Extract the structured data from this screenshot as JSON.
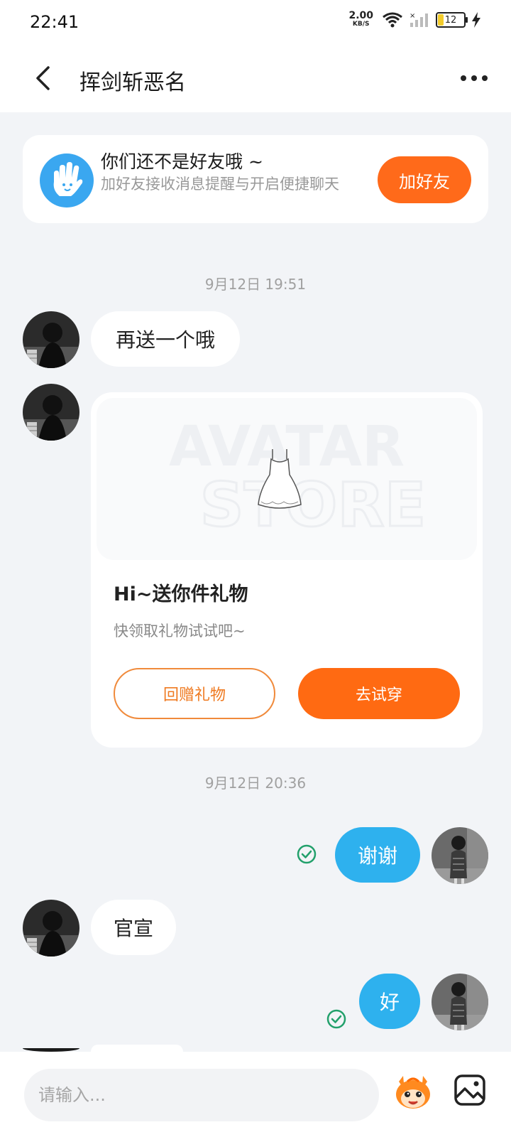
{
  "status_bar": {
    "time": "22:41",
    "net_speed_value": "2.00",
    "net_speed_unit": "KB/S",
    "battery_level": "12"
  },
  "header": {
    "title": "挥剑斩恶名"
  },
  "friend_notice": {
    "title": "你们还不是好友哦 ~",
    "subtitle": "加好友接收消息提醒与开启便捷聊天",
    "button_label": "加好友"
  },
  "messages": {
    "timestamp_1": "9月12日 19:51",
    "msg_1": "再送一个哦",
    "gift": {
      "watermark_line1": "AVATAR",
      "watermark_line2": "STORE",
      "title": "Hi~送你件礼物",
      "subtitle": "快领取礼物试试吧~",
      "return_label": "回赠礼物",
      "tryon_label": "去试穿"
    },
    "timestamp_2": "9月12日 20:36",
    "msg_out_1": "谢谢",
    "msg_2": "官宣",
    "msg_out_2": "好"
  },
  "input_bar": {
    "placeholder": "请输入..."
  },
  "colors": {
    "accent_orange": "#ff6a1a",
    "bubble_blue": "#2eb1ee",
    "read_check_green": "#22a06b",
    "notice_icon_blue": "#3aa7f0"
  }
}
